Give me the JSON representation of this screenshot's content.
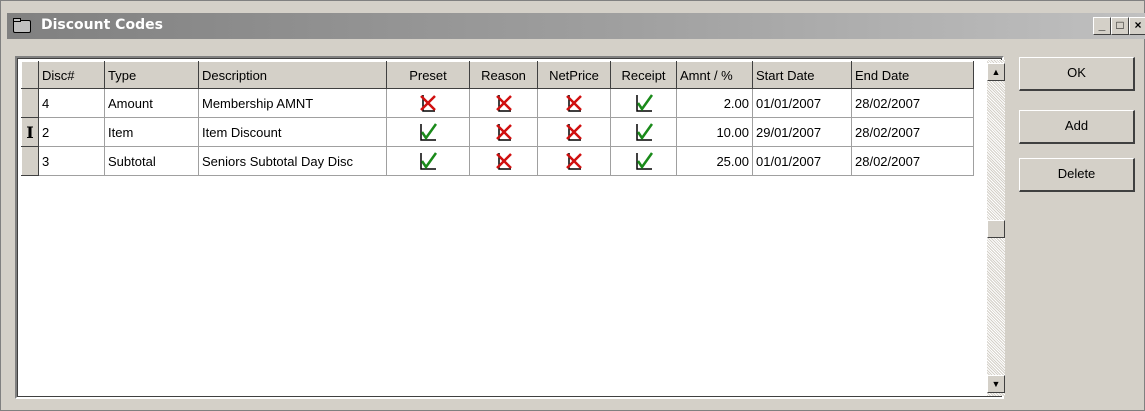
{
  "window": {
    "title": "Discount Codes",
    "min_label": "_",
    "max_label": "□",
    "close_label": "×"
  },
  "grid": {
    "columns": [
      "Disc#",
      "Type",
      "Description",
      "Preset",
      "Reason",
      "NetPrice",
      "Receipt",
      "Amnt / %",
      "Start Date",
      "End Date"
    ],
    "rows": [
      {
        "disc": "4",
        "type": "Amount",
        "description": "Membership AMNT",
        "preset": false,
        "reason": false,
        "netprice": false,
        "receipt": true,
        "amount": "2.00",
        "start": "01/01/2007",
        "end": "28/02/2007"
      },
      {
        "disc": "2",
        "type": "Item",
        "description": "Item Discount",
        "preset": true,
        "reason": false,
        "netprice": false,
        "receipt": true,
        "amount": "10.00",
        "start": "29/01/2007",
        "end": "28/02/2007"
      },
      {
        "disc": "3",
        "type": "Subtotal",
        "description": "Seniors Subtotal Day Disc",
        "preset": true,
        "reason": false,
        "netprice": false,
        "receipt": true,
        "amount": "25.00",
        "start": "01/01/2007",
        "end": "28/02/2007"
      }
    ],
    "current_row_marker": "I"
  },
  "buttons": {
    "ok": "OK",
    "add": "Add",
    "delete": "Delete"
  },
  "icons": {
    "checked": "green-check-icon",
    "unchecked": "red-x-icon",
    "scroll_up": "arrow-up-icon",
    "scroll_down": "arrow-down-icon",
    "title": "folder-icon"
  },
  "colors": {
    "check_green": "#1a8a1a",
    "cross_red": "#d01010",
    "title_grad_start": "#808080",
    "title_grad_end": "#c0c0c0"
  }
}
